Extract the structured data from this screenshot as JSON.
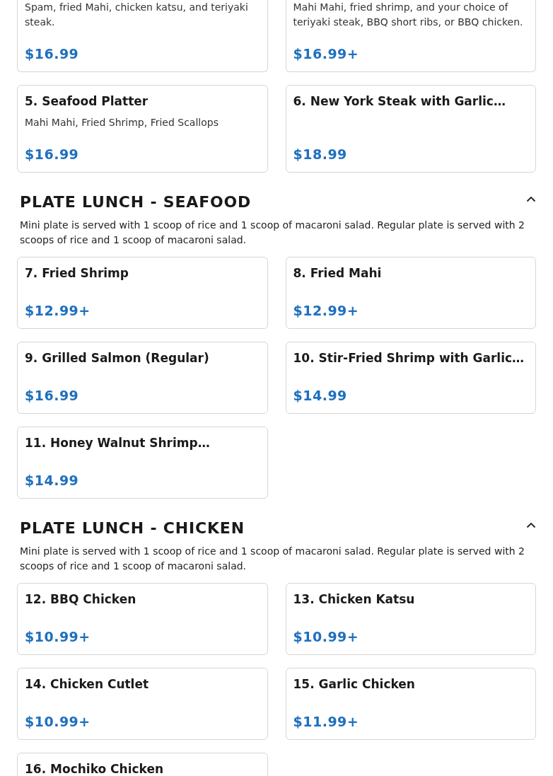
{
  "sections": [
    {
      "items": [
        {
          "description": "Spam, fried Mahi, chicken katsu, and teriyaki steak.",
          "price": "$16.99"
        },
        {
          "description": "Mahi Mahi, fried shrimp, and your choice of teriyaki steak, BBQ short ribs, or BBQ chicken.",
          "price": "$16.99+"
        },
        {
          "name": "5. Seafood Platter",
          "description": "Mahi Mahi, Fried Shrimp, Fried Scallops",
          "price": "$16.99"
        },
        {
          "name": "6. New York Steak with Garlic…",
          "price": "$18.99"
        }
      ]
    },
    {
      "title": "PLATE LUNCH - SEAFOOD",
      "expanded": true,
      "description": "Mini plate is served with 1 scoop of rice and 1 scoop of macaroni salad. Regular plate is served with 2 scoops of rice and 1 scoop of macaroni salad.",
      "items": [
        {
          "name": "7. Fried Shrimp",
          "price": "$12.99+"
        },
        {
          "name": "8. Fried Mahi",
          "price": "$12.99+"
        },
        {
          "name": "9. Grilled Salmon (Regular)",
          "price": "$16.99"
        },
        {
          "name": "10. Stir-Fried Shrimp with Garlic…",
          "price": "$14.99"
        },
        {
          "name": "11. Honey Walnut Shrimp…",
          "price": "$14.99"
        }
      ]
    },
    {
      "title": "PLATE LUNCH - CHICKEN",
      "expanded": true,
      "description": "Mini plate is served with 1 scoop of rice and 1 scoop of macaroni salad. Regular plate is served with 2 scoops of rice and 1 scoop of macaroni salad.",
      "items": [
        {
          "name": "12. BBQ Chicken",
          "price": "$10.99+"
        },
        {
          "name": "13. Chicken Katsu",
          "price": "$10.99+"
        },
        {
          "name": "14. Chicken Cutlet",
          "price": "$10.99+"
        },
        {
          "name": "15. Garlic Chicken",
          "price": "$11.99+"
        },
        {
          "name": "16. Mochiko Chicken"
        }
      ]
    }
  ]
}
